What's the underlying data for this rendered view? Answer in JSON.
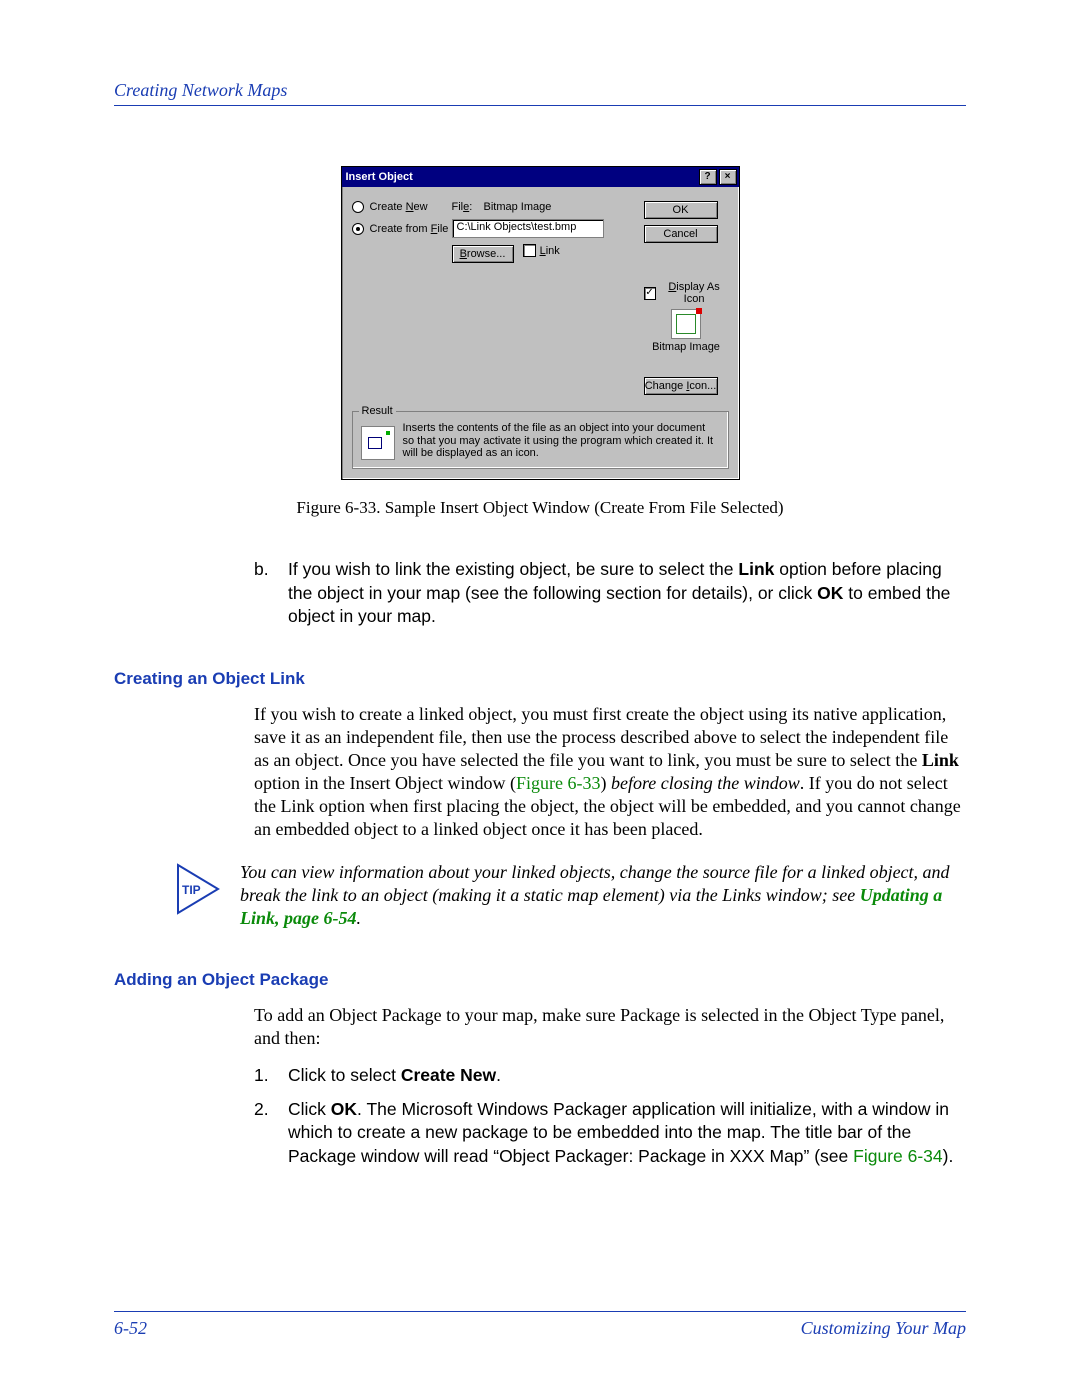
{
  "header": {
    "section": "Creating Network Maps"
  },
  "dialog": {
    "title": "Insert Object",
    "radio_new": "Create New",
    "radio_new_u": "N",
    "radio_file": "Create from File",
    "radio_file_u": "F",
    "file_label": "File:",
    "file_label_u": "e",
    "file_type": "Bitmap Image",
    "file_path": "C:\\Link Objects\\test.bmp",
    "browse": "Browse...",
    "browse_u": "B",
    "link": "Link",
    "link_u": "L",
    "ok": "OK",
    "cancel": "Cancel",
    "display_as_icon": "Display As Icon",
    "display_as_icon_u": "D",
    "icon_caption": "Bitmap Image",
    "change_icon": "Change Icon...",
    "change_icon_u": "I",
    "result_legend": "Result",
    "result_text": "Inserts the contents of the file as an object into your document so that you may activate it using the program which created it.  It will be displayed as an icon."
  },
  "caption": "Figure 6-33.  Sample Insert Object Window (Create From File Selected)",
  "step_b": {
    "marker": "b.",
    "t1": "If you wish to link the existing object, be sure to select the ",
    "bold1": "Link",
    "t2": " option before placing the object in your map (see the following section for details), or click ",
    "bold2": "OK",
    "t3": " to embed the object in your map."
  },
  "sec1": {
    "heading": "Creating an Object Link",
    "p1a": "If you wish to create a linked object, you must first create the object using its native application, save it as an independent file, then use the process described above to select the independent file as an object. Once you have selected the file you want to link, you must be sure to select the ",
    "p1b": "Link",
    "p1c": " option in the Insert Object window (",
    "p1ref": "Figure 6-33",
    "p1d": ") ",
    "p1e": "before closing the window",
    "p1f": ". If you do not select the Link option when first placing the object, the object will be embedded, and you cannot change an embedded object to a linked object once it has been placed."
  },
  "tip": {
    "label": "TIP",
    "t1": "You can view information about your linked objects, change the source file for a linked object, and break the link to an object (making it a static map element) via the Links window; see ",
    "ref": "Updating a Link",
    "page": ", page 6-54",
    "t2": "."
  },
  "sec2": {
    "heading": "Adding an Object Package",
    "intro": "To add an Object Package to your map, make sure Package is selected in the Object Type panel, and then:",
    "s1m": "1.",
    "s1a": "Click to select ",
    "s1b": "Create New",
    "s1c": ".",
    "s2m": "2.",
    "s2a": "Click ",
    "s2b": "OK",
    "s2c": ". The Microsoft Windows Packager application will initialize, with a window in which to create a new package to be embedded into the map. The title bar of the Package window will read “Object Packager: Package in XXX Map” (see ",
    "s2ref": "Figure 6-34",
    "s2d": ")."
  },
  "footer": {
    "page": "6-52",
    "section": "Customizing Your Map"
  }
}
